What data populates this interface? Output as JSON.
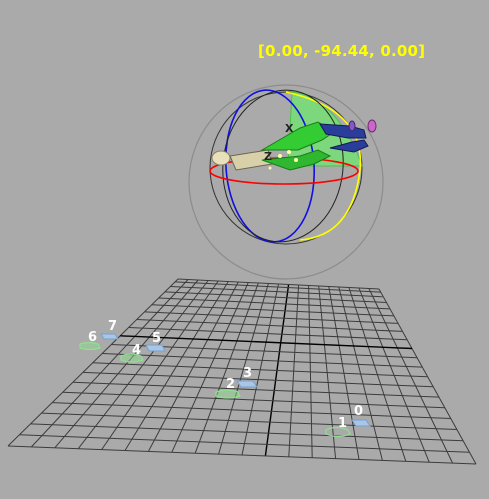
{
  "viewport": {
    "rotation_readout": "[0.00, -94.44, 0.00]",
    "rotation_readout_color": "#ffff00",
    "background_color": "#aaaaaa"
  },
  "gizmo": {
    "axis_x_color": "#ff0000",
    "axis_y_color": "#0000ff",
    "axis_z_color": "#ffff00",
    "active_sector_color": "#6ee66e",
    "screen_circle_color": "#8c8c8c",
    "center_label": "X",
    "side_label": "Z"
  },
  "footstep_markers": [
    {
      "label": "0"
    },
    {
      "label": "1"
    },
    {
      "label": "2"
    },
    {
      "label": "3"
    },
    {
      "label": "4"
    },
    {
      "label": "5"
    },
    {
      "label": "6"
    },
    {
      "label": "7"
    }
  ],
  "grid": {
    "line_color": "#3c3c3c",
    "axis_line_color": "#000000"
  }
}
